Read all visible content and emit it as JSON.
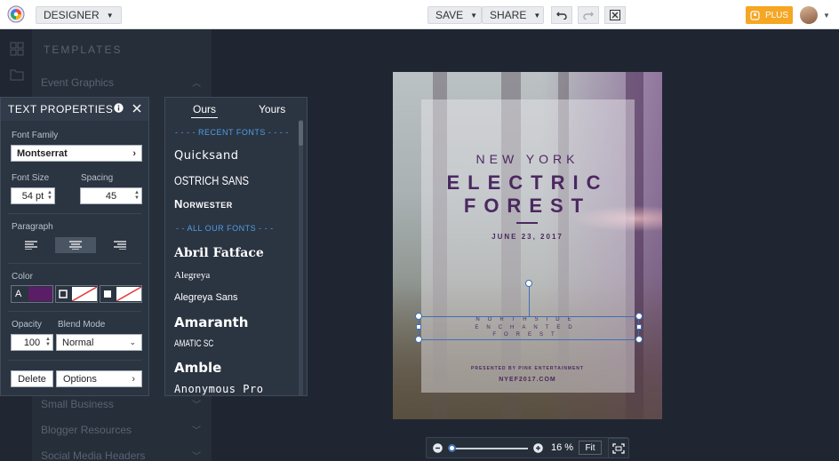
{
  "topbar": {
    "mode_label": "DESIGNER",
    "save_label": "SAVE",
    "share_label": "SHARE",
    "plus_label": "PLUS"
  },
  "templates": {
    "title": "TEMPLATES",
    "items": [
      {
        "label": "Event Graphics",
        "expanded": true
      },
      {
        "label": "Small Business",
        "expanded": false
      },
      {
        "label": "Blogger Resources",
        "expanded": false
      },
      {
        "label": "Social Media Headers",
        "expanded": false
      }
    ]
  },
  "text_properties": {
    "title": "TEXT PROPERTIES",
    "font_family_label": "Font Family",
    "font_family_value": "Montserrat",
    "font_size_label": "Font Size",
    "font_size_value": "54 pt",
    "spacing_label": "Spacing",
    "spacing_value": "45",
    "paragraph_label": "Paragraph",
    "color_label": "Color",
    "text_color_glyph": "A",
    "text_color": "#5a1e66",
    "opacity_label": "Opacity",
    "opacity_value": "100",
    "blend_mode_label": "Blend Mode",
    "blend_mode_value": "Normal",
    "delete_label": "Delete",
    "options_label": "Options"
  },
  "font_panel": {
    "tabs": [
      "Ours",
      "Yours"
    ],
    "active_tab": "Ours",
    "recent_heading": "- - - - RECENT FONTS - - - -",
    "recent_fonts": [
      "Quicksand",
      "OSTRICH SANS",
      "Norwester"
    ],
    "all_heading": "- - ALL OUR FONTS - - -",
    "all_fonts": [
      "Abril Fatface",
      "Alegreya",
      "Alegreya Sans",
      "Amaranth",
      "AMATIC SC",
      "Amble",
      "Anonymous Pro"
    ]
  },
  "poster": {
    "line1": "NEW YORK",
    "line2": "ELECTRIC",
    "line3": "FOREST",
    "date": "JUNE 23, 2017",
    "sub1": "NORTHSIDE",
    "sub2": "ENCHANTED",
    "sub3": "FOREST",
    "presented": "PRESENTED BY PINK ENTERTAINMENT",
    "url": "NYEF2017.COM"
  },
  "zoom": {
    "level": "16 %",
    "fit_label": "Fit",
    "slider_fraction": 0.0
  },
  "colors": {
    "accent_blue": "#4f9fe6",
    "plus_orange": "#f5a623",
    "poster_purple": "#4b2860"
  }
}
